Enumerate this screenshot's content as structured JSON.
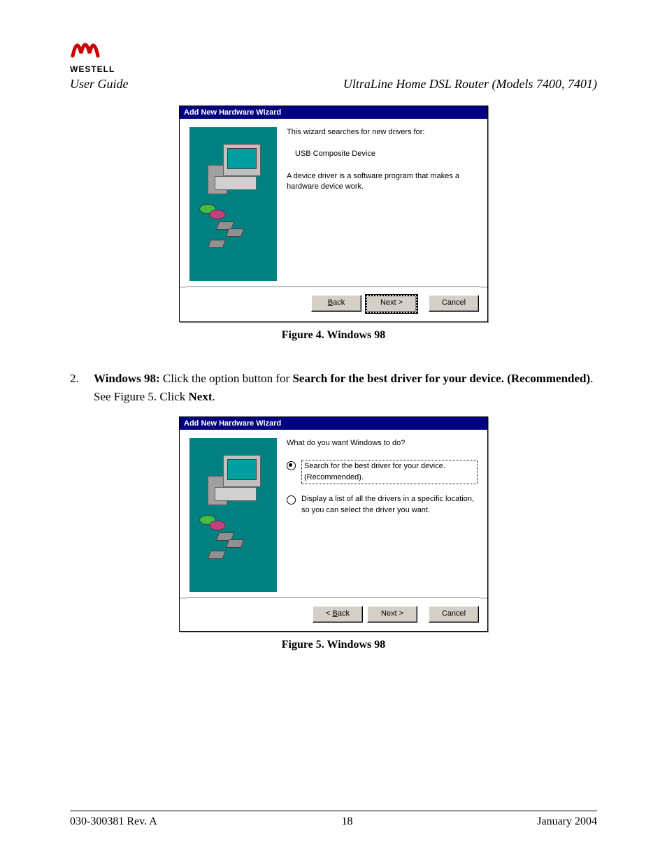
{
  "header": {
    "brand": "WESTELL",
    "left": "User Guide",
    "right": "UltraLine Home DSL Router (Models 7400, 7401)"
  },
  "dialog1": {
    "title": "Add New Hardware Wizard",
    "line1": "This wizard searches for new drivers for:",
    "line2": "USB Composite Device",
    "line3": "A device driver is a software program that makes a hardware device work.",
    "back": "< Back",
    "next": "Next >",
    "cancel": "Cancel"
  },
  "caption1": "Figure 4. Windows 98",
  "step2": {
    "num": "2.",
    "os": "Windows 98:",
    "a": "  Click the option button for ",
    "bold": "Search for the best driver for your device. (Recommended)",
    "b": ". See Figure 5. Click ",
    "next": "Next",
    "c": "."
  },
  "dialog2": {
    "title": "Add New Hardware Wizard",
    "prompt": "What do you want Windows to do?",
    "opt1": "Search for the best driver for your device. (Recommended).",
    "opt2": "Display a list of all the drivers in a specific location, so you can select the driver you want.",
    "back": "< Back",
    "next": "Next >",
    "cancel": "Cancel"
  },
  "caption2": "Figure 5.  Windows 98",
  "footer": {
    "left": "030-300381 Rev. A",
    "center": "18",
    "right": "January 2004"
  }
}
